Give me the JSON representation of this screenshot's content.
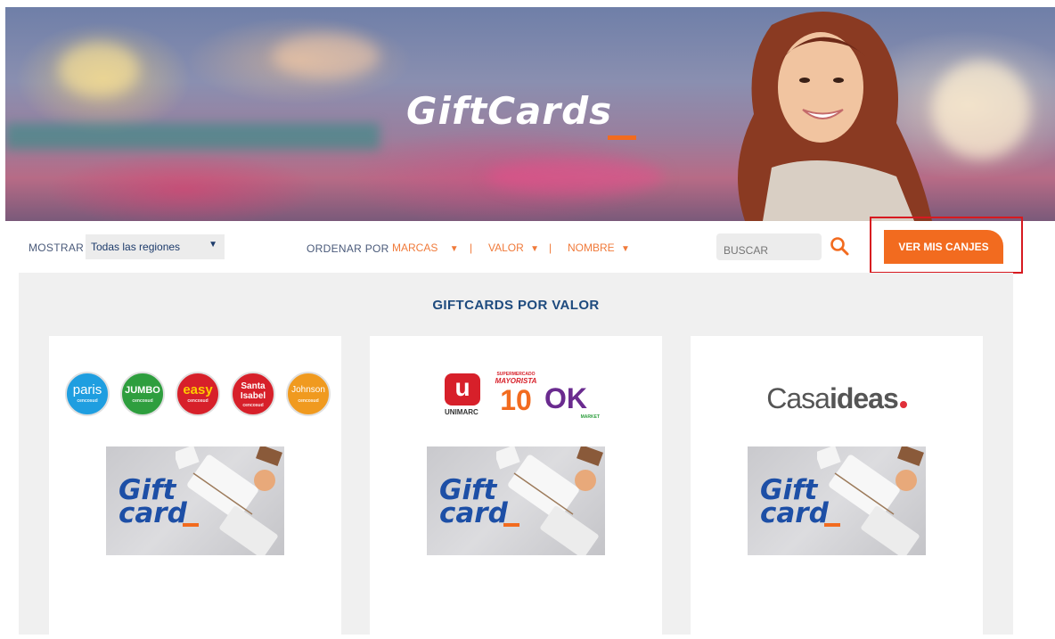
{
  "hero": {
    "title": "GiftCards"
  },
  "filters": {
    "show_label": "MOSTRAR",
    "region_value": "Todas las regiones",
    "sort_label": "ORDENAR POR",
    "sort_options": [
      "MARCAS",
      "VALOR",
      "NOMBRE"
    ],
    "search_placeholder": "BUSCAR",
    "canjes_button": "VER MIS CANJES"
  },
  "section": {
    "title": "GIFTCARDS POR VALOR"
  },
  "cards": [
    {
      "brands": [
        {
          "name": "paris",
          "sub": "cencosud",
          "color": "#1f9ee0"
        },
        {
          "name": "JUMBO",
          "sub": "cencosud",
          "color": "#2e9e3e"
        },
        {
          "name": "easy",
          "sub": "cencosud",
          "color": "#d7202a"
        },
        {
          "name": "Santa Isabel",
          "sub": "cencosud",
          "color": "#d7202a"
        },
        {
          "name": "Johnson",
          "sub": "cencosud",
          "color": "#f09a1f"
        }
      ],
      "image_text_1": "Gift",
      "image_text_2": "card"
    },
    {
      "brands": [
        {
          "name": "UNIMARC",
          "color": "#d7202a"
        },
        {
          "name": "SUPERMERCADO MAYORISTA 10",
          "color": "#f26b1f"
        },
        {
          "name": "OK MARKET",
          "color": "#6a2b8f"
        }
      ],
      "unimarc_letter": "u",
      "unimarc_text": "UNIMARC",
      "mayorista_top": "SUPERMERCADO",
      "mayorista_mid": "MAYORISTA",
      "mayorista_num": "10",
      "ok_text": "OK",
      "ok_sub": "MARKET",
      "image_text_1": "Gift",
      "image_text_2": "card"
    },
    {
      "brand_text_1": "Casa",
      "brand_text_2": "ideas",
      "image_text_1": "Gift",
      "image_text_2": "card"
    }
  ],
  "colors": {
    "accent": "#f26b1f",
    "navy": "#1d4a7e",
    "highlight": "#d71a20"
  }
}
